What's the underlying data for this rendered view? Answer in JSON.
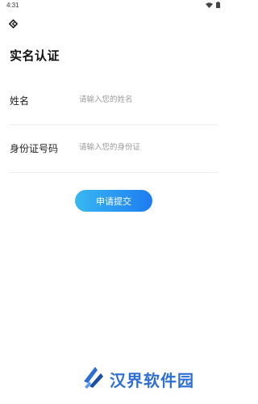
{
  "status_bar": {
    "time": "4:31"
  },
  "header": {
    "title": "实名认证"
  },
  "form": {
    "name": {
      "label": "姓名",
      "placeholder": "请输入您的姓名",
      "value": ""
    },
    "id_number": {
      "label": "身份证号码",
      "placeholder": "请输入您的身份证",
      "value": ""
    }
  },
  "actions": {
    "submit_label": "申请提交"
  },
  "watermark": {
    "text": "汉界软件园"
  },
  "colors": {
    "accent_start": "#38b8f2",
    "accent_end": "#1e7cf0",
    "watermark": "#2e6fd6"
  },
  "icons": {
    "back": "diamond-back-icon",
    "wifi": "wifi-icon",
    "battery": "battery-icon",
    "watermark_logo": "logo-icon"
  }
}
